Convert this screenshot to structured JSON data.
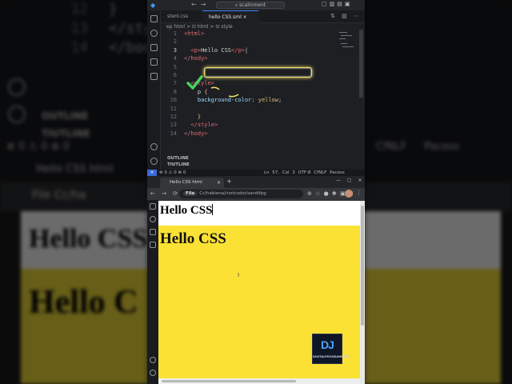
{
  "background": {
    "code_lines": [
      {
        "num": "12",
        "text": "}"
      },
      {
        "num": "13",
        "text": "</style>"
      },
      {
        "num": "14",
        "text": "</body>"
      }
    ],
    "outline": "OUTLINE",
    "timeline": "TIUTLINE",
    "status_left": "⊗ 0 ⚠ 0 ⊗ 0",
    "status_right": "CfNLF Pacess",
    "tab_title": "Hello CSS html",
    "url_text": "File Cc/ha",
    "page_text_1": "Hello CSS",
    "page_text_2": "Hello C"
  },
  "vscode": {
    "search": "scalinment",
    "tabs": [
      {
        "label": "stenl.css"
      },
      {
        "label": "hello CSS.sml ×"
      }
    ],
    "breadcrumb": "ep html > ⊡ html > ⊡ style",
    "lines": [
      {
        "num": "1",
        "parts": [
          {
            "cls": "tag",
            "t": "<html>"
          }
        ]
      },
      {
        "num": "2",
        "parts": []
      },
      {
        "num": "3",
        "parts": [
          {
            "cls": "tag",
            "t": "  <p>"
          },
          {
            "cls": "txt",
            "t": "Hello CSS"
          },
          {
            "cls": "tag",
            "t": "</p>"
          },
          {
            "cls": "txt",
            "t": "|"
          }
        ]
      },
      {
        "num": "4",
        "parts": [
          {
            "cls": "tag",
            "t": "</hody>"
          }
        ]
      },
      {
        "num": "5",
        "parts": []
      },
      {
        "num": "6",
        "parts": []
      },
      {
        "num": "7",
        "parts": [
          {
            "cls": "tag",
            "t": "  <style>"
          }
        ]
      },
      {
        "num": "8",
        "parts": [
          {
            "cls": "txt",
            "t": "    p "
          },
          {
            "cls": "brace",
            "t": "{"
          }
        ]
      },
      {
        "num": "10",
        "parts": [
          {
            "cls": "prop",
            "t": "    background-color"
          },
          {
            "cls": "txt",
            "t": ": "
          },
          {
            "cls": "val",
            "t": "yellow"
          },
          {
            "cls": "txt",
            "t": ";"
          }
        ]
      },
      {
        "num": "11",
        "parts": []
      },
      {
        "num": "12",
        "parts": [
          {
            "cls": "brace",
            "t": "    }"
          }
        ]
      },
      {
        "num": "13",
        "parts": [
          {
            "cls": "tag",
            "t": "  </style>"
          }
        ]
      },
      {
        "num": "14",
        "parts": [
          {
            "cls": "tag",
            "t": "</hody>"
          }
        ]
      }
    ],
    "outline": "OUTLINE",
    "timeline": "TIUTLINE",
    "status_left": "⊗ 0 ⚠ 0   ⊗ 0",
    "status_right": "Ln 57, Col 3   UTF-8   CfNLF   Pacess"
  },
  "browser": {
    "tab_title": "Hello CSS html",
    "url_chip": "File",
    "url_path": "Cc/habiena/inotcodoi/sandifpg",
    "page_p": "Hello CSS",
    "page_div": "Hello CSS",
    "watermark_logo": "DJ",
    "watermark_text": "DIGITALPROGRAMMING"
  },
  "colors": {
    "page_yellow": "#fbe134",
    "highlight": "#f1e36a",
    "check": "#46d160"
  }
}
